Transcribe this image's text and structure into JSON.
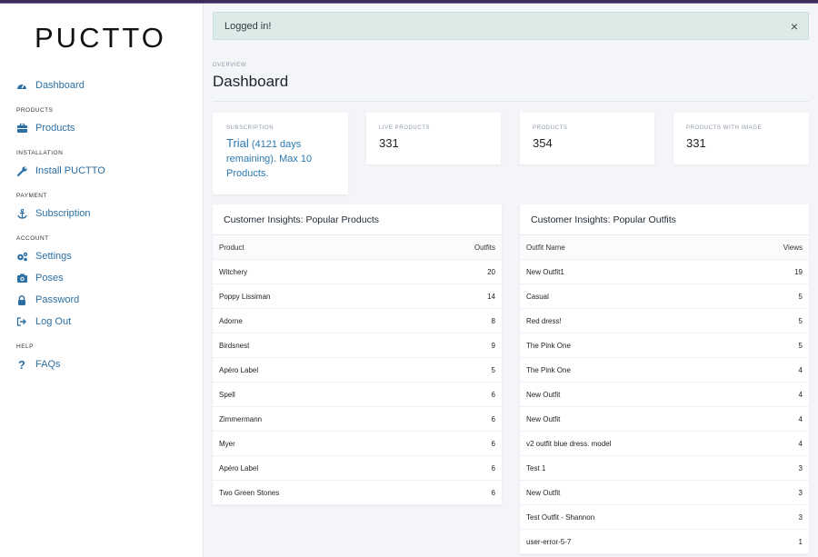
{
  "app": {
    "logo": "PUCTTO"
  },
  "sidebar": {
    "items": [
      {
        "type": "link",
        "label": "Dashboard",
        "icon": "dashboard-icon"
      },
      {
        "type": "section",
        "label": "PRODUCTS"
      },
      {
        "type": "link",
        "label": "Products",
        "icon": "products-icon"
      },
      {
        "type": "section",
        "label": "INSTALLATION"
      },
      {
        "type": "link",
        "label": "Install PUCTTO",
        "icon": "wrench-icon"
      },
      {
        "type": "section",
        "label": "PAYMENT"
      },
      {
        "type": "link",
        "label": "Subscription",
        "icon": "anchor-icon"
      },
      {
        "type": "section",
        "label": "ACCOUNT"
      },
      {
        "type": "link",
        "label": "Settings",
        "icon": "gears-icon"
      },
      {
        "type": "link",
        "label": "Poses",
        "icon": "camera-icon"
      },
      {
        "type": "link",
        "label": "Password",
        "icon": "lock-icon"
      },
      {
        "type": "link",
        "label": "Log Out",
        "icon": "logout-icon"
      },
      {
        "type": "section",
        "label": "HELP"
      },
      {
        "type": "link",
        "label": "FAQs",
        "icon": "question-icon"
      }
    ]
  },
  "alert": {
    "message": "Logged in!",
    "close": "×"
  },
  "header": {
    "overview": "OVERVIEW",
    "title": "Dashboard"
  },
  "stats": {
    "subscription": {
      "label": "SUBSCRIPTION",
      "plan": "Trial",
      "detail": " (4121 days remaining). Max 10 Products."
    },
    "live_products": {
      "label": "LIVE PRODUCTS",
      "value": "331"
    },
    "products": {
      "label": "PRODUCTS",
      "value": "354"
    },
    "products_with_image": {
      "label": "PRODUCTS WITH IMAGE",
      "value": "331"
    }
  },
  "popular_products": {
    "title": "Customer Insights: Popular Products",
    "columns": [
      "Product",
      "Outfits"
    ],
    "rows": [
      [
        "Witchery",
        "20"
      ],
      [
        "Poppy Lissiman",
        "14"
      ],
      [
        "Adorne",
        "8"
      ],
      [
        "Birdsnest",
        "9"
      ],
      [
        "Apéro Label",
        "5"
      ],
      [
        "Spell",
        "6"
      ],
      [
        "Zimmermann",
        "6"
      ],
      [
        "Myer",
        "6"
      ],
      [
        "Apéro Label",
        "6"
      ],
      [
        "Two Green Stones",
        "6"
      ]
    ]
  },
  "popular_outfits": {
    "title": "Customer Insights: Popular Outfits",
    "columns": [
      "Outfit Name",
      "Views"
    ],
    "rows": [
      [
        "New Outfit1",
        "19"
      ],
      [
        "Casual",
        "5"
      ],
      [
        "Red dress!",
        "5"
      ],
      [
        "The Pink One",
        "5"
      ],
      [
        "The Pink One",
        "4"
      ],
      [
        "New Outfit",
        "4"
      ],
      [
        "New Outfit",
        "4"
      ],
      [
        "v2 outfit blue dress. model",
        "4"
      ],
      [
        "Test 1",
        "3"
      ],
      [
        "New Outfit",
        "3"
      ],
      [
        "Test Outfit - Shannon",
        "3"
      ],
      [
        "user-error-5-7",
        "1"
      ]
    ]
  }
}
